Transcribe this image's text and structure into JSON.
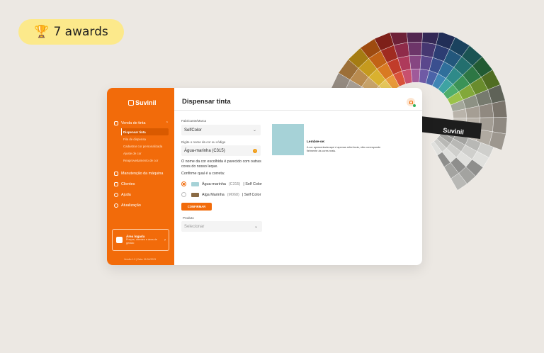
{
  "awards": {
    "icon": "trophy-icon",
    "label": "7 awards"
  },
  "fan_deck": {
    "brand": "Suvinil"
  },
  "app": {
    "logo": "Suvinil",
    "page_title": "Dispensar tinta",
    "sidebar": {
      "sections": [
        {
          "label": "Venda de tinta",
          "icon": "paint-bucket-icon",
          "expanded": true,
          "children": [
            {
              "label": "Dispensar tinta",
              "active": true
            },
            {
              "label": "Fila de dispensa"
            },
            {
              "label": "Cadastrar cor personalizada"
            },
            {
              "label": "Ajuste de cor"
            },
            {
              "label": "Reaproveitamento de cor"
            }
          ]
        },
        {
          "label": "Manutenção da máquina",
          "icon": "wrench-icon"
        },
        {
          "label": "Clientes",
          "icon": "users-icon"
        },
        {
          "label": "Ajuda",
          "icon": "help-icon"
        },
        {
          "label": "Atualização",
          "icon": "refresh-icon"
        }
      ],
      "login_box": {
        "title": "Área logada",
        "description": "Preços, clientes e área de gestão"
      },
      "version": "Versão 1.0 | Data: 01/04/2023"
    },
    "form": {
      "brand_label": "Fabricante/Marca",
      "brand_value": "SelfColor",
      "color_label": "Digite o nome da cor ou código",
      "color_value": "Água-marinha (C315)",
      "similar_notice": "O nome da cor escolhida é parecido com outras cores do nosso leque.",
      "confirm_prompt": "Confirme qual é a correta:",
      "options": [
        {
          "name": "Água-marinha",
          "code": "(C315)",
          "line": "| Self Color",
          "swatch": "#a6d2d7",
          "selected": true
        },
        {
          "name": "Alga Marinha",
          "code": "(M068)",
          "line": "| Self Color",
          "swatch": "#8a6a44",
          "selected": false
        }
      ],
      "confirm_button": "CONFIRMAR",
      "product_label": "Produto",
      "product_placeholder": "Selecionar"
    },
    "preview": {
      "color": "#a6d2d7",
      "title": "Lembre-se:",
      "text": "A cor apresentada aqui é apenas referência, não corresponde fielmente às cores reais."
    },
    "colors": {
      "accent": "#f26b0a",
      "accent_dark": "#d95a00",
      "background": "#ece8e3",
      "badge": "#fce98b"
    }
  }
}
